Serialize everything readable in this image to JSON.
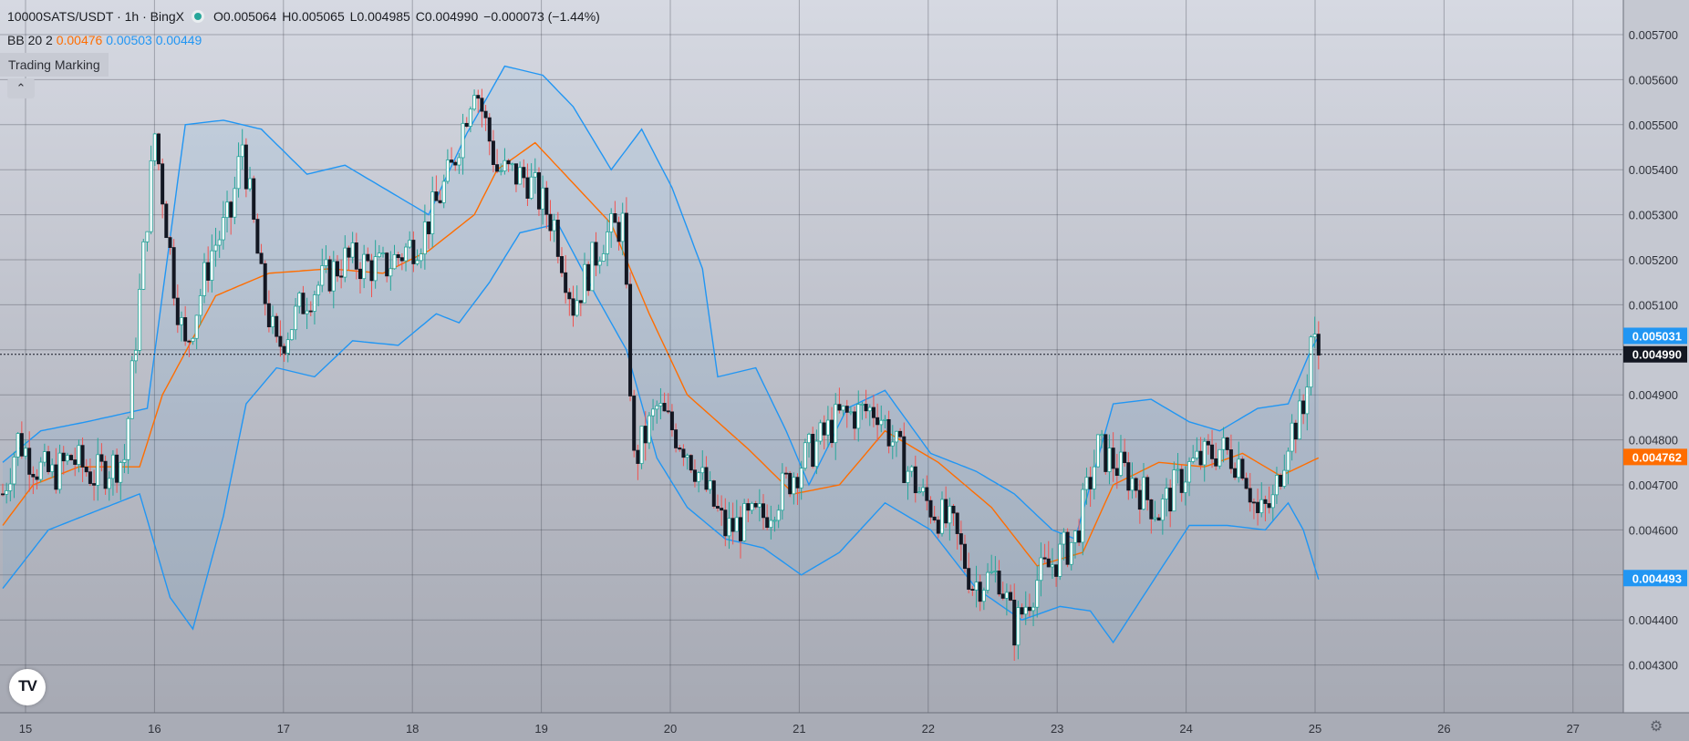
{
  "header": {
    "symbol": "10000SATS/USDT · 1h · BingX",
    "ohlc": [
      {
        "label": "O",
        "value": "0.005064"
      },
      {
        "label": "H",
        "value": "0.005065"
      },
      {
        "label": "L",
        "value": "0.004985"
      },
      {
        "label": "C",
        "value": "0.004990"
      }
    ],
    "change": "−0.000073 (−1.44%)",
    "indicator": {
      "name": "BB 20 2",
      "basis": "0.00476",
      "upper": "0.00503",
      "lower": "0.00449"
    },
    "trading_marking": "Trading Marking",
    "collapse_glyph": "⌃"
  },
  "colors": {
    "up": "#26a69a",
    "up_fill": "#ffffff",
    "down": "#131722",
    "wick_down": "#ef5350",
    "basis": "#ff6d00",
    "band": "#2196f3",
    "band_fill": "rgba(33,150,243,0.07)",
    "crosshair": "#131722"
  },
  "chart_data": {
    "type": "candlestick",
    "ylim": [
      0.00425,
      0.00575
    ],
    "y_ticks": [
      "0.004300",
      "0.004400",
      "0.004500",
      "0.004600",
      "0.004700",
      "0.004800",
      "0.004900",
      "0.005000",
      "0.005100",
      "0.005200",
      "0.005300",
      "0.005400",
      "0.005500",
      "0.005600",
      "0.005700"
    ],
    "x_ticks": [
      "15",
      "16",
      "17",
      "18",
      "19",
      "20",
      "21",
      "22",
      "23",
      "24",
      "25",
      "26",
      "27"
    ],
    "price_labels": [
      {
        "text": "0.005031",
        "value": 0.005031,
        "color": "#2196f3"
      },
      {
        "text": "0.004990",
        "value": 0.00499,
        "color": "#131722"
      },
      {
        "text": "0.004762",
        "value": 0.004762,
        "color": "#ff6d00"
      },
      {
        "text": "0.004493",
        "value": 0.004493,
        "color": "#2196f3"
      }
    ],
    "crosshair_price": 0.00499,
    "series_keypoints": {
      "close": [
        [
          0,
          0.00468
        ],
        [
          4,
          0.0048
        ],
        [
          9,
          0.00474
        ],
        [
          13,
          0.00472
        ],
        [
          18,
          0.00476
        ],
        [
          24,
          0.00472
        ],
        [
          32,
          0.00476
        ],
        [
          40,
          0.00548
        ],
        [
          45,
          0.00515
        ],
        [
          48,
          0.005
        ],
        [
          55,
          0.00522
        ],
        [
          60,
          0.0053
        ],
        [
          63,
          0.00546
        ],
        [
          68,
          0.00515
        ],
        [
          72,
          0.005
        ],
        [
          80,
          0.00512
        ],
        [
          90,
          0.0052
        ],
        [
          100,
          0.00518
        ],
        [
          110,
          0.00525
        ],
        [
          118,
          0.0054
        ],
        [
          124,
          0.0056
        ],
        [
          130,
          0.0054
        ],
        [
          138,
          0.00538
        ],
        [
          145,
          0.00528
        ],
        [
          150,
          0.0051
        ],
        [
          158,
          0.00525
        ],
        [
          163,
          0.00528
        ],
        [
          166,
          0.00475
        ],
        [
          172,
          0.00487
        ],
        [
          180,
          0.00478
        ],
        [
          190,
          0.0046
        ],
        [
          200,
          0.00463
        ],
        [
          210,
          0.00475
        ],
        [
          220,
          0.00485
        ],
        [
          230,
          0.00487
        ],
        [
          235,
          0.00478
        ],
        [
          242,
          0.00467
        ],
        [
          250,
          0.0046
        ],
        [
          255,
          0.00448
        ],
        [
          262,
          0.0045
        ],
        [
          266,
          0.00438
        ],
        [
          272,
          0.00449
        ],
        [
          282,
          0.00458
        ],
        [
          288,
          0.00478
        ],
        [
          296,
          0.00472
        ],
        [
          304,
          0.00464
        ],
        [
          312,
          0.00474
        ],
        [
          320,
          0.00478
        ],
        [
          326,
          0.00475
        ],
        [
          330,
          0.00463
        ],
        [
          334,
          0.00466
        ],
        [
          338,
          0.00481
        ],
        [
          342,
          0.00486
        ],
        [
          344,
          0.00503
        ],
        [
          346,
          0.00499
        ]
      ],
      "basis": [
        [
          0,
          0.00461
        ],
        [
          8,
          0.0047
        ],
        [
          20,
          0.00474
        ],
        [
          36,
          0.00474
        ],
        [
          42,
          0.0049
        ],
        [
          56,
          0.00512
        ],
        [
          70,
          0.00517
        ],
        [
          86,
          0.00518
        ],
        [
          100,
          0.00517
        ],
        [
          112,
          0.00522
        ],
        [
          124,
          0.0053
        ],
        [
          130,
          0.0054
        ],
        [
          140,
          0.00546
        ],
        [
          150,
          0.00537
        ],
        [
          160,
          0.00528
        ],
        [
          170,
          0.00508
        ],
        [
          180,
          0.0049
        ],
        [
          196,
          0.00478
        ],
        [
          208,
          0.00468
        ],
        [
          220,
          0.0047
        ],
        [
          232,
          0.00482
        ],
        [
          246,
          0.00475
        ],
        [
          260,
          0.00465
        ],
        [
          272,
          0.00452
        ],
        [
          284,
          0.00455
        ],
        [
          292,
          0.0047
        ],
        [
          304,
          0.00475
        ],
        [
          316,
          0.00474
        ],
        [
          326,
          0.00477
        ],
        [
          336,
          0.00472
        ],
        [
          346,
          0.00476
        ]
      ],
      "upper": [
        [
          0,
          0.00475
        ],
        [
          10,
          0.00482
        ],
        [
          22,
          0.00484
        ],
        [
          38,
          0.00487
        ],
        [
          48,
          0.0055
        ],
        [
          58,
          0.00551
        ],
        [
          68,
          0.00549
        ],
        [
          80,
          0.00539
        ],
        [
          90,
          0.00541
        ],
        [
          100,
          0.00536
        ],
        [
          112,
          0.0053
        ],
        [
          122,
          0.00548
        ],
        [
          132,
          0.00563
        ],
        [
          142,
          0.00561
        ],
        [
          150,
          0.00554
        ],
        [
          160,
          0.0054
        ],
        [
          168,
          0.00549
        ],
        [
          176,
          0.00536
        ],
        [
          184,
          0.00518
        ],
        [
          188,
          0.00494
        ],
        [
          198,
          0.00496
        ],
        [
          206,
          0.00482
        ],
        [
          212,
          0.0047
        ],
        [
          222,
          0.00487
        ],
        [
          232,
          0.00491
        ],
        [
          244,
          0.00477
        ],
        [
          256,
          0.00473
        ],
        [
          266,
          0.00468
        ],
        [
          276,
          0.0046
        ],
        [
          282,
          0.00458
        ],
        [
          292,
          0.00488
        ],
        [
          302,
          0.00489
        ],
        [
          312,
          0.00484
        ],
        [
          320,
          0.00482
        ],
        [
          330,
          0.00487
        ],
        [
          338,
          0.00488
        ],
        [
          344,
          0.005
        ],
        [
          346,
          0.00503
        ]
      ],
      "lower": [
        [
          0,
          0.00447
        ],
        [
          12,
          0.0046
        ],
        [
          24,
          0.00464
        ],
        [
          36,
          0.00468
        ],
        [
          44,
          0.00445
        ],
        [
          50,
          0.00438
        ],
        [
          58,
          0.00463
        ],
        [
          64,
          0.00488
        ],
        [
          72,
          0.00496
        ],
        [
          82,
          0.00494
        ],
        [
          92,
          0.00502
        ],
        [
          104,
          0.00501
        ],
        [
          114,
          0.00508
        ],
        [
          120,
          0.00506
        ],
        [
          128,
          0.00515
        ],
        [
          136,
          0.00526
        ],
        [
          146,
          0.00528
        ],
        [
          156,
          0.00512
        ],
        [
          164,
          0.005
        ],
        [
          172,
          0.00476
        ],
        [
          180,
          0.00465
        ],
        [
          190,
          0.00458
        ],
        [
          200,
          0.00456
        ],
        [
          210,
          0.0045
        ],
        [
          220,
          0.00455
        ],
        [
          232,
          0.00466
        ],
        [
          244,
          0.0046
        ],
        [
          256,
          0.00447
        ],
        [
          268,
          0.0044
        ],
        [
          278,
          0.00443
        ],
        [
          286,
          0.00442
        ],
        [
          292,
          0.00435
        ],
        [
          302,
          0.00448
        ],
        [
          312,
          0.00461
        ],
        [
          322,
          0.00461
        ],
        [
          332,
          0.0046
        ],
        [
          338,
          0.00466
        ],
        [
          342,
          0.0046
        ],
        [
          346,
          0.00449
        ]
      ]
    },
    "candle_count": 347
  }
}
